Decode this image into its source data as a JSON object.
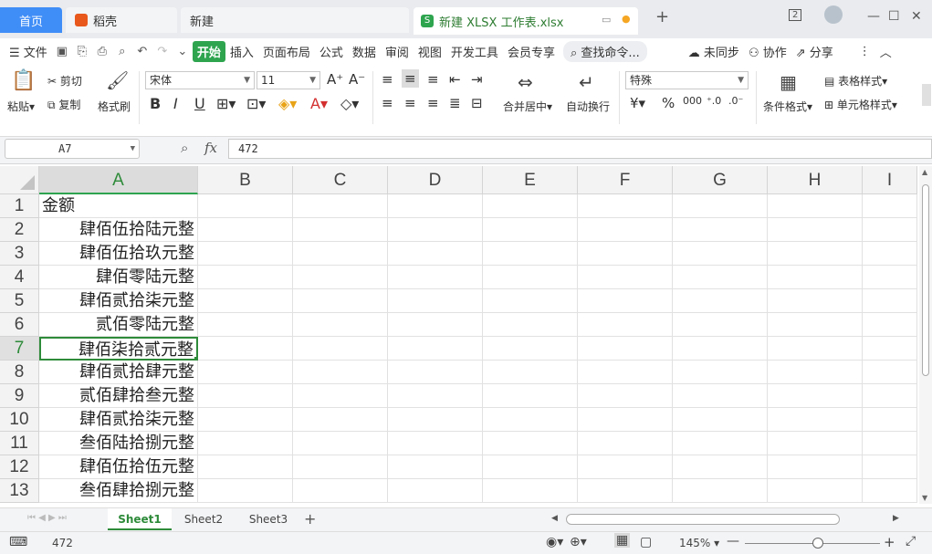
{
  "tabs": {
    "home": "首页",
    "docer": "稻壳",
    "new": "新建",
    "active_file": "新建 XLSX 工作表.xlsx",
    "add": "+",
    "window_count": "2"
  },
  "menu": {
    "file": "文件",
    "items": [
      "开始",
      "插入",
      "页面布局",
      "公式",
      "数据",
      "审阅",
      "视图",
      "开发工具",
      "会员专享"
    ],
    "search": "查找命令...",
    "unsynced": "未同步",
    "collaborate": "协作",
    "share": "分享"
  },
  "ribbon": {
    "paste": "粘贴",
    "cut": "剪切",
    "copy": "复制",
    "format_painter": "格式刷",
    "font_name": "宋体",
    "font_size": "11",
    "number_format": "特殊",
    "merge_center": "合并居中",
    "wrap_text": "自动换行",
    "conditional_format": "条件格式",
    "table_style": "表格样式",
    "cell_style": "单元格样式",
    "currency_symbol": "¥",
    "percent_symbol": "%",
    "thousands": "000"
  },
  "formula_bar": {
    "cell_ref": "A7",
    "fx": "fx",
    "value": "472"
  },
  "sheet": {
    "columns": [
      "A",
      "B",
      "C",
      "D",
      "E",
      "F",
      "G",
      "H",
      "I"
    ],
    "rows": [
      "1",
      "2",
      "3",
      "4",
      "5",
      "6",
      "7",
      "8",
      "9",
      "10",
      "11",
      "12",
      "13"
    ],
    "cells_a": [
      "金额",
      "肆佰伍拾陆元整",
      "肆佰伍拾玖元整",
      "肆佰零陆元整",
      "肆佰贰拾柒元整",
      "贰佰零陆元整",
      "肆佰柒拾贰元整",
      "肆佰贰拾肆元整",
      "贰佰肆拾叁元整",
      "肆佰贰拾柒元整",
      "叁佰陆拾捌元整",
      "肆佰伍拾伍元整",
      "叁佰肆拾捌元整"
    ],
    "selected_row": "7",
    "selected_col": "A"
  },
  "sheet_tabs": [
    "Sheet1",
    "Sheet2",
    "Sheet3"
  ],
  "status": {
    "value": "472",
    "zoom": "145%"
  },
  "colors": {
    "accent": "#2e8b3a",
    "home_tab": "#3f8df7"
  }
}
